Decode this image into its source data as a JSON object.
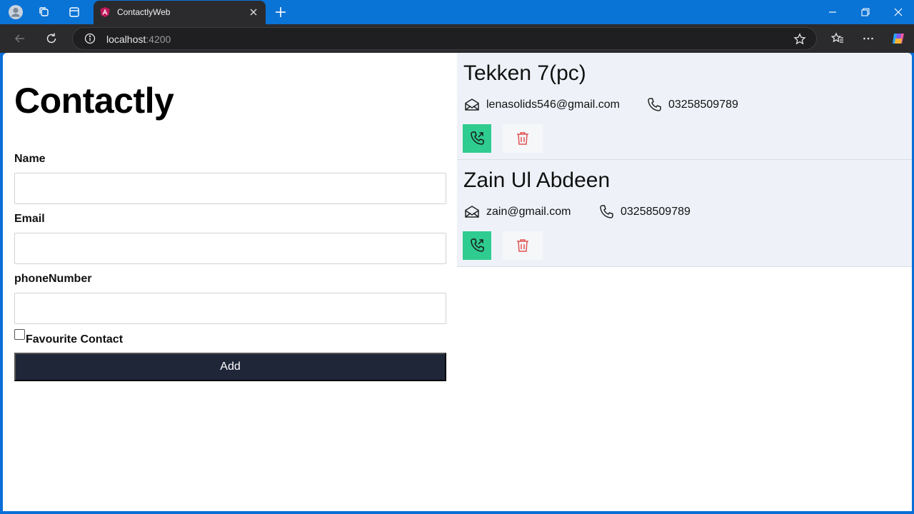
{
  "browser": {
    "tab_title": "ContactlyWeb",
    "url_host": "localhost",
    "url_port": ":4200"
  },
  "app": {
    "title": "Contactly",
    "form": {
      "name_label": "Name",
      "name_value": "",
      "email_label": "Email",
      "email_value": "",
      "phone_label": "phoneNumber",
      "phone_value": "",
      "favourite_label": "Favourite Contact",
      "favourite_checked": false,
      "add_label": "Add"
    },
    "contacts": [
      {
        "name": "Tekken 7(pc)",
        "email": "lenasolids546@gmail.com",
        "phone": "03258509789"
      },
      {
        "name": "Zain Ul Abdeen",
        "email": "zain@gmail.com",
        "phone": "03258509789"
      }
    ]
  },
  "colors": {
    "titlebar": "#0a73d6",
    "toolbar": "#2b2b2e",
    "add_button": "#1e2638",
    "call_button": "#2ecc8f",
    "delete_icon": "#e05252",
    "card_bg": "#eef2f8"
  }
}
